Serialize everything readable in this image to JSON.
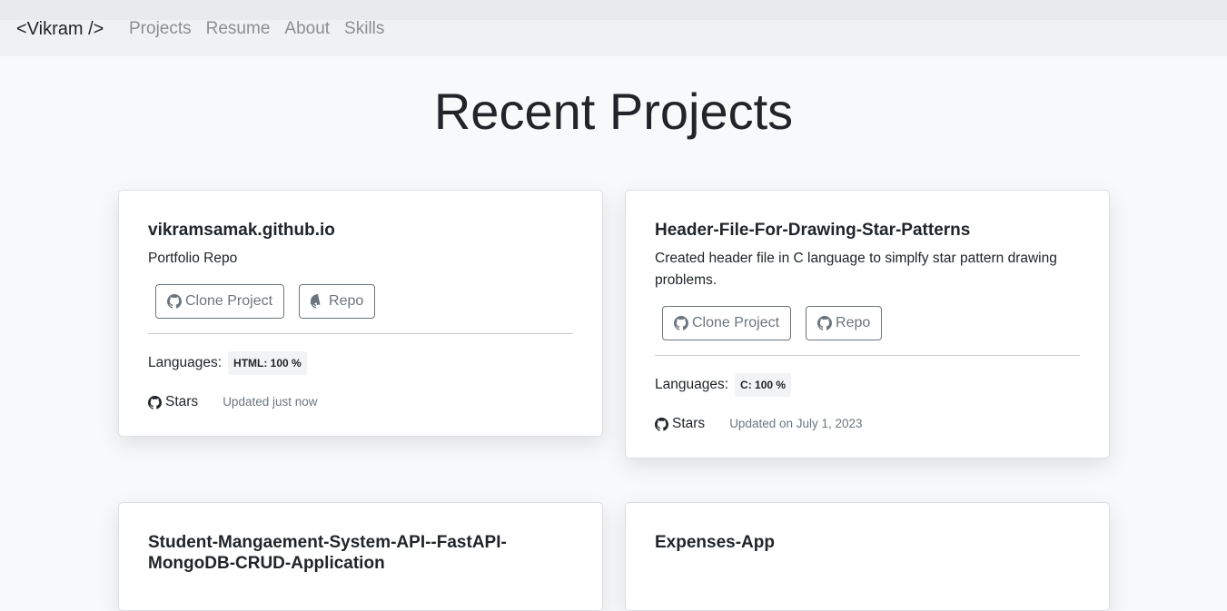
{
  "nav": {
    "brand": "<Vikram />",
    "links": [
      "Projects",
      "Resume",
      "About",
      "Skills"
    ]
  },
  "page_title": "Recent Projects",
  "ui_labels": {
    "clone": "Clone Project",
    "repo": "Repo",
    "languages": "Languages:",
    "stars": "Stars"
  },
  "projects": [
    {
      "title": "vikramsamak.github.io",
      "description": "Portfolio Repo",
      "language": "HTML: 100 %",
      "updated": "Updated just now"
    },
    {
      "title": "Header-File-For-Drawing-Star-Patterns",
      "description": "Created header file in C language to simplfy star pattern drawing problems.",
      "language": "C: 100 %",
      "updated": "Updated on July 1, 2023"
    },
    {
      "title": "Student-Mangaement-System-API--FastAPI-MongoDB-CRUD-Application",
      "description": ""
    },
    {
      "title": "Expenses-App",
      "description": ""
    }
  ],
  "icons": {
    "github": "github-icon"
  },
  "colors": {
    "background": "#f8f9fa",
    "navbar": "#f0f1f3",
    "nav_link": "#8a8f94",
    "button_outline": "#6c757d",
    "card": "#ffffff"
  }
}
